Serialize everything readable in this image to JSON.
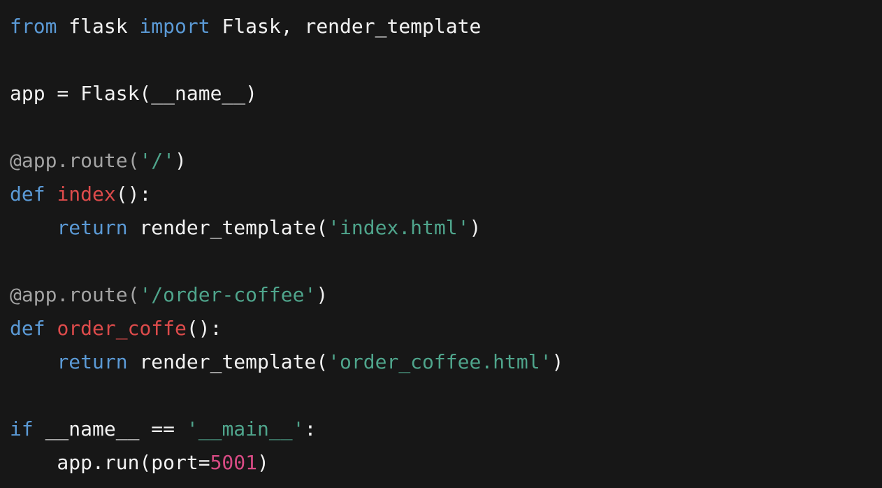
{
  "colors": {
    "background": "#171717",
    "default_text": "#f2f2f2",
    "keyword": "#5b9ad6",
    "function_name": "#dd4b4b",
    "string": "#4fa58c",
    "decorator": "#a4a4a4",
    "number": "#d84b84"
  },
  "code": {
    "lines": [
      [
        {
          "text": "from",
          "type": "keyword"
        },
        {
          "text": " flask ",
          "type": "plain"
        },
        {
          "text": "import",
          "type": "keyword"
        },
        {
          "text": " Flask, render_template",
          "type": "plain"
        }
      ],
      [],
      [
        {
          "text": "app = Flask(__name__)",
          "type": "plain"
        }
      ],
      [],
      [
        {
          "text": "@app.route(",
          "type": "decorator"
        },
        {
          "text": "'/'",
          "type": "string"
        },
        {
          "text": ")",
          "type": "plain"
        }
      ],
      [
        {
          "text": "def",
          "type": "keyword"
        },
        {
          "text": " ",
          "type": "plain"
        },
        {
          "text": "index",
          "type": "funcname"
        },
        {
          "text": "():",
          "type": "plain"
        }
      ],
      [
        {
          "text": "    ",
          "type": "plain"
        },
        {
          "text": "return",
          "type": "keyword"
        },
        {
          "text": " render_template(",
          "type": "plain"
        },
        {
          "text": "'index.html'",
          "type": "string"
        },
        {
          "text": ")",
          "type": "plain"
        }
      ],
      [],
      [
        {
          "text": "@app.route(",
          "type": "decorator"
        },
        {
          "text": "'/order-coffee'",
          "type": "string"
        },
        {
          "text": ")",
          "type": "plain"
        }
      ],
      [
        {
          "text": "def",
          "type": "keyword"
        },
        {
          "text": " ",
          "type": "plain"
        },
        {
          "text": "order_coffe",
          "type": "funcname"
        },
        {
          "text": "():",
          "type": "plain"
        }
      ],
      [
        {
          "text": "    ",
          "type": "plain"
        },
        {
          "text": "return",
          "type": "keyword"
        },
        {
          "text": " render_template(",
          "type": "plain"
        },
        {
          "text": "'order_coffee.html'",
          "type": "string"
        },
        {
          "text": ")",
          "type": "plain"
        }
      ],
      [],
      [
        {
          "text": "if",
          "type": "keyword"
        },
        {
          "text": " __name__ == ",
          "type": "plain"
        },
        {
          "text": "'__main__'",
          "type": "string"
        },
        {
          "text": ":",
          "type": "plain"
        }
      ],
      [
        {
          "text": "    app.run(port=",
          "type": "plain"
        },
        {
          "text": "5001",
          "type": "number"
        },
        {
          "text": ")",
          "type": "plain"
        }
      ]
    ]
  }
}
